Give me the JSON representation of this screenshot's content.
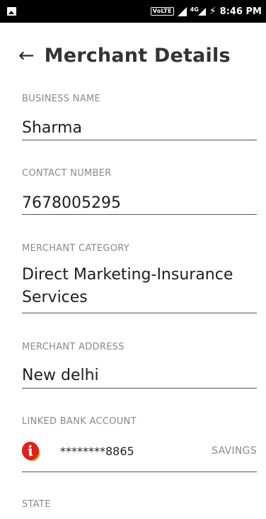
{
  "status_bar": {
    "volte": "VoLTE",
    "network": "4G",
    "time": "8:46 PM"
  },
  "header": {
    "title": "Merchant Details",
    "back_glyph": "←"
  },
  "fields": {
    "business_name": {
      "label": "BUSINESS NAME",
      "value": "Sharma"
    },
    "contact_number": {
      "label": "CONTACT NUMBER",
      "value": "7678005295"
    },
    "merchant_category": {
      "label": "MERCHANT CATEGORY",
      "value": "Direct Marketing-Insurance Services"
    },
    "merchant_address": {
      "label": "MERCHANT ADDRESS",
      "value": "New delhi"
    },
    "linked_bank_account": {
      "label": "LINKED BANK ACCOUNT",
      "bank_logo_letter": "i",
      "account_number": "********8865",
      "account_type": "SAVINGS"
    },
    "state": {
      "label": "STATE"
    }
  }
}
